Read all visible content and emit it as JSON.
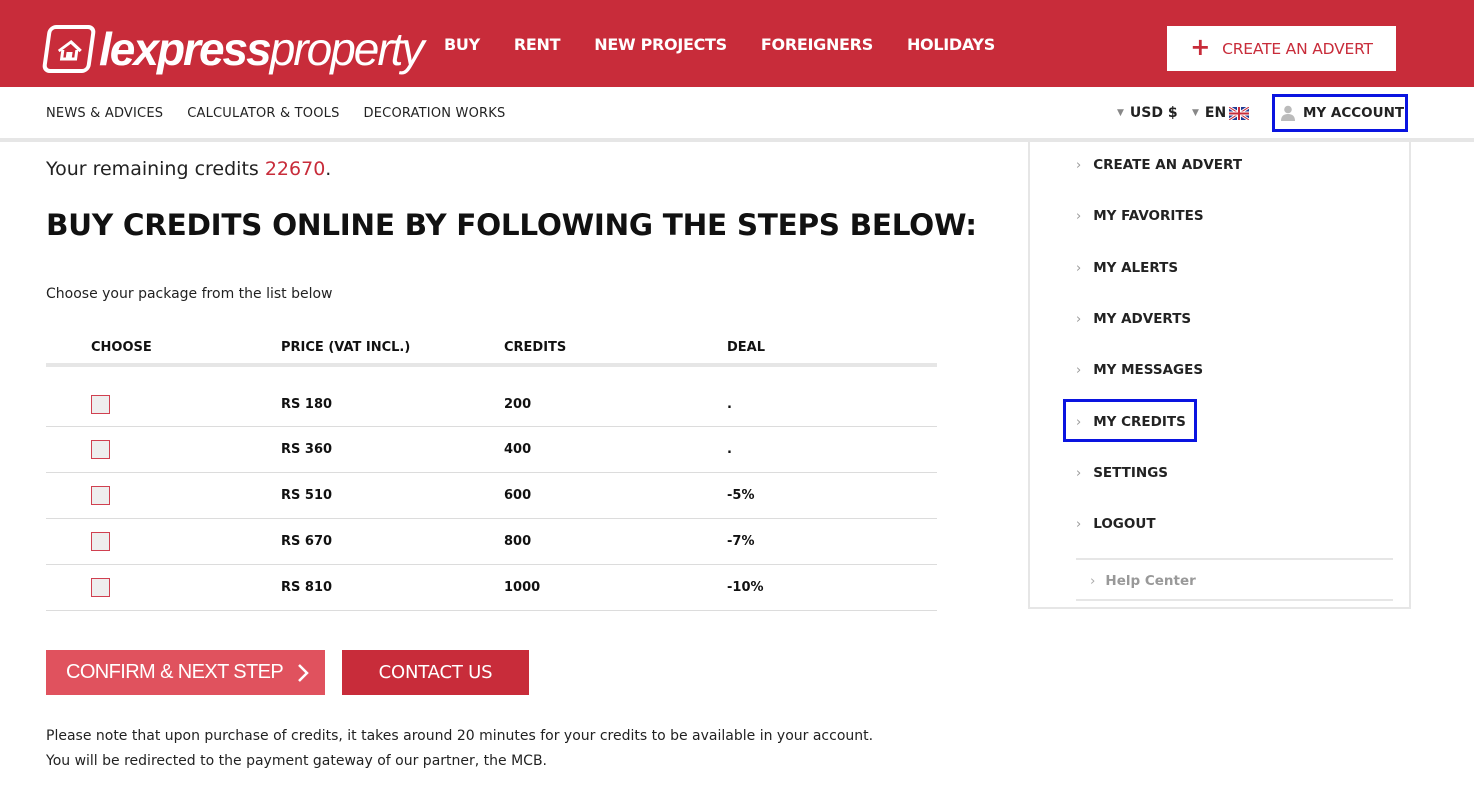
{
  "brand": {
    "logo_bold": "lexpress",
    "logo_light": "property",
    "accent_color": "#c82c3a"
  },
  "main_nav": [
    "BUY",
    "RENT",
    "NEW PROJECTS",
    "FOREIGNERS",
    "HOLIDAYS"
  ],
  "header": {
    "create_advert_label": "CREATE AN ADVERT",
    "plus_icon": "+"
  },
  "sub_nav": [
    "NEWS & ADVICES",
    "CALCULATOR & TOOLS",
    "DECORATION WORKS"
  ],
  "account_bar": {
    "currency": "USD $",
    "language": "EN",
    "account_label": "MY ACCOUNT"
  },
  "credits": {
    "prefix": "Your remaining credits ",
    "value": "22670",
    "suffix": "."
  },
  "page_title": "BUY CREDITS ONLINE BY FOLLOWING THE STEPS BELOW:",
  "choose_hint": "Choose your package from the list below",
  "table": {
    "headers": [
      "CHOOSE",
      "PRICE (VAT INCL.)",
      "CREDITS",
      "DEAL"
    ],
    "rows": [
      {
        "price": "RS 180",
        "credits": "200",
        "deal": ".",
        "checked": false
      },
      {
        "price": "RS 360",
        "credits": "400",
        "deal": ".",
        "checked": false
      },
      {
        "price": "RS 510",
        "credits": "600",
        "deal": "-5%",
        "checked": false
      },
      {
        "price": "RS 670",
        "credits": "800",
        "deal": "-7%",
        "checked": false
      },
      {
        "price": "RS 810",
        "credits": "1000",
        "deal": "-10%",
        "checked": false
      }
    ]
  },
  "actions": {
    "confirm_label": "CONFIRM & NEXT STEP",
    "contact_label": "CONTACT US"
  },
  "notes": [
    "Please note that upon purchase of credits, it takes around 20 minutes for your credits to be available in your account.",
    "You will be redirected to the payment gateway of our partner, the MCB."
  ],
  "account_menu": {
    "items": [
      "CREATE AN ADVERT",
      "MY FAVORITES",
      "MY ALERTS",
      "MY ADVERTS",
      "MY MESSAGES",
      "MY CREDITS",
      "SETTINGS",
      "LOGOUT"
    ],
    "help_label": "Help Center",
    "arrow_glyph": "›"
  }
}
